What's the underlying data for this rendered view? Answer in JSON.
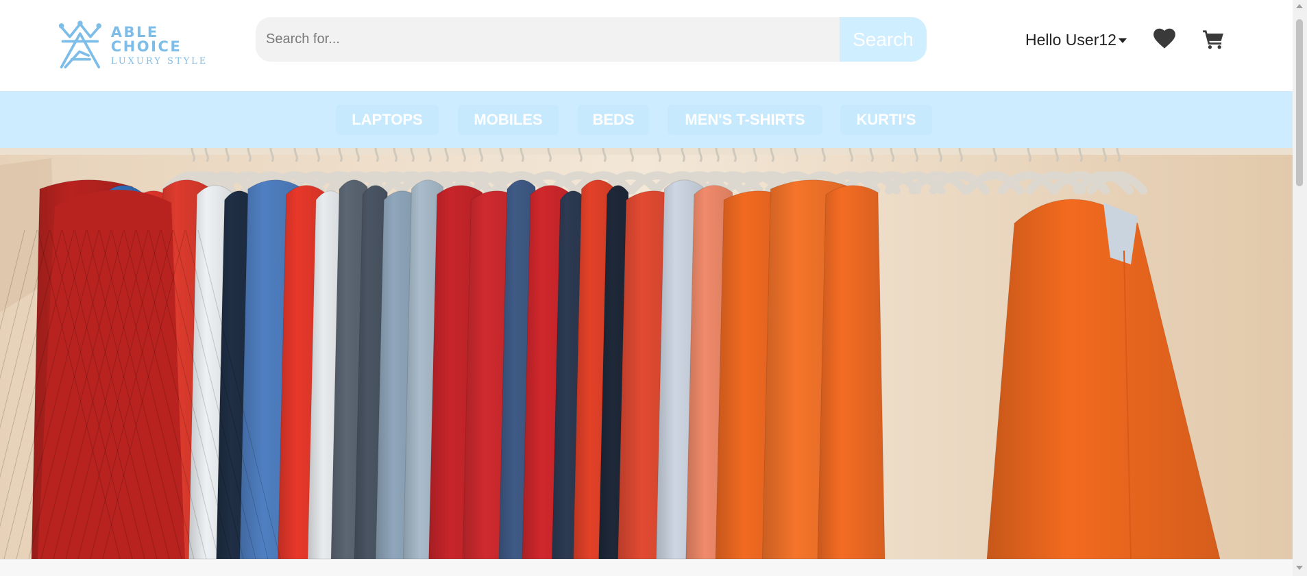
{
  "brand": {
    "name": "ABLE CHOICE",
    "tagline": "LUXURY STYLE",
    "color": "#7dbde8"
  },
  "search": {
    "placeholder": "Search for...",
    "value": "",
    "button_label": "Search"
  },
  "user_menu": {
    "greeting": "Hello User12"
  },
  "header_icons": {
    "wishlist": "heart-icon",
    "cart": "shopping-cart-icon"
  },
  "nav": {
    "items": [
      {
        "label": "LAPTOPS"
      },
      {
        "label": "MOBILES"
      },
      {
        "label": "BEDS"
      },
      {
        "label": "MEN'S T-SHIRTS"
      },
      {
        "label": "KURTI'S"
      }
    ]
  },
  "hero": {
    "image": "clothing-rack-banner"
  },
  "colors": {
    "nav_background": "#cdecff",
    "search_button": "#cfeeff",
    "accent": "#7dbde8"
  }
}
